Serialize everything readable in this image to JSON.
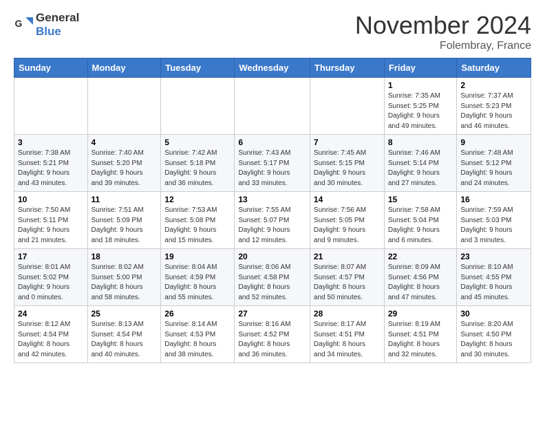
{
  "header": {
    "logo_general": "General",
    "logo_blue": "Blue",
    "month": "November 2024",
    "location": "Folembray, France"
  },
  "weekdays": [
    "Sunday",
    "Monday",
    "Tuesday",
    "Wednesday",
    "Thursday",
    "Friday",
    "Saturday"
  ],
  "weeks": [
    [
      {
        "day": "",
        "info": ""
      },
      {
        "day": "",
        "info": ""
      },
      {
        "day": "",
        "info": ""
      },
      {
        "day": "",
        "info": ""
      },
      {
        "day": "",
        "info": ""
      },
      {
        "day": "1",
        "info": "Sunrise: 7:35 AM\nSunset: 5:25 PM\nDaylight: 9 hours\nand 49 minutes."
      },
      {
        "day": "2",
        "info": "Sunrise: 7:37 AM\nSunset: 5:23 PM\nDaylight: 9 hours\nand 46 minutes."
      }
    ],
    [
      {
        "day": "3",
        "info": "Sunrise: 7:38 AM\nSunset: 5:21 PM\nDaylight: 9 hours\nand 43 minutes."
      },
      {
        "day": "4",
        "info": "Sunrise: 7:40 AM\nSunset: 5:20 PM\nDaylight: 9 hours\nand 39 minutes."
      },
      {
        "day": "5",
        "info": "Sunrise: 7:42 AM\nSunset: 5:18 PM\nDaylight: 9 hours\nand 36 minutes."
      },
      {
        "day": "6",
        "info": "Sunrise: 7:43 AM\nSunset: 5:17 PM\nDaylight: 9 hours\nand 33 minutes."
      },
      {
        "day": "7",
        "info": "Sunrise: 7:45 AM\nSunset: 5:15 PM\nDaylight: 9 hours\nand 30 minutes."
      },
      {
        "day": "8",
        "info": "Sunrise: 7:46 AM\nSunset: 5:14 PM\nDaylight: 9 hours\nand 27 minutes."
      },
      {
        "day": "9",
        "info": "Sunrise: 7:48 AM\nSunset: 5:12 PM\nDaylight: 9 hours\nand 24 minutes."
      }
    ],
    [
      {
        "day": "10",
        "info": "Sunrise: 7:50 AM\nSunset: 5:11 PM\nDaylight: 9 hours\nand 21 minutes."
      },
      {
        "day": "11",
        "info": "Sunrise: 7:51 AM\nSunset: 5:09 PM\nDaylight: 9 hours\nand 18 minutes."
      },
      {
        "day": "12",
        "info": "Sunrise: 7:53 AM\nSunset: 5:08 PM\nDaylight: 9 hours\nand 15 minutes."
      },
      {
        "day": "13",
        "info": "Sunrise: 7:55 AM\nSunset: 5:07 PM\nDaylight: 9 hours\nand 12 minutes."
      },
      {
        "day": "14",
        "info": "Sunrise: 7:56 AM\nSunset: 5:05 PM\nDaylight: 9 hours\nand 9 minutes."
      },
      {
        "day": "15",
        "info": "Sunrise: 7:58 AM\nSunset: 5:04 PM\nDaylight: 9 hours\nand 6 minutes."
      },
      {
        "day": "16",
        "info": "Sunrise: 7:59 AM\nSunset: 5:03 PM\nDaylight: 9 hours\nand 3 minutes."
      }
    ],
    [
      {
        "day": "17",
        "info": "Sunrise: 8:01 AM\nSunset: 5:02 PM\nDaylight: 9 hours\nand 0 minutes."
      },
      {
        "day": "18",
        "info": "Sunrise: 8:02 AM\nSunset: 5:00 PM\nDaylight: 8 hours\nand 58 minutes."
      },
      {
        "day": "19",
        "info": "Sunrise: 8:04 AM\nSunset: 4:59 PM\nDaylight: 8 hours\nand 55 minutes."
      },
      {
        "day": "20",
        "info": "Sunrise: 8:06 AM\nSunset: 4:58 PM\nDaylight: 8 hours\nand 52 minutes."
      },
      {
        "day": "21",
        "info": "Sunrise: 8:07 AM\nSunset: 4:57 PM\nDaylight: 8 hours\nand 50 minutes."
      },
      {
        "day": "22",
        "info": "Sunrise: 8:09 AM\nSunset: 4:56 PM\nDaylight: 8 hours\nand 47 minutes."
      },
      {
        "day": "23",
        "info": "Sunrise: 8:10 AM\nSunset: 4:55 PM\nDaylight: 8 hours\nand 45 minutes."
      }
    ],
    [
      {
        "day": "24",
        "info": "Sunrise: 8:12 AM\nSunset: 4:54 PM\nDaylight: 8 hours\nand 42 minutes."
      },
      {
        "day": "25",
        "info": "Sunrise: 8:13 AM\nSunset: 4:54 PM\nDaylight: 8 hours\nand 40 minutes."
      },
      {
        "day": "26",
        "info": "Sunrise: 8:14 AM\nSunset: 4:53 PM\nDaylight: 8 hours\nand 38 minutes."
      },
      {
        "day": "27",
        "info": "Sunrise: 8:16 AM\nSunset: 4:52 PM\nDaylight: 8 hours\nand 36 minutes."
      },
      {
        "day": "28",
        "info": "Sunrise: 8:17 AM\nSunset: 4:51 PM\nDaylight: 8 hours\nand 34 minutes."
      },
      {
        "day": "29",
        "info": "Sunrise: 8:19 AM\nSunset: 4:51 PM\nDaylight: 8 hours\nand 32 minutes."
      },
      {
        "day": "30",
        "info": "Sunrise: 8:20 AM\nSunset: 4:50 PM\nDaylight: 8 hours\nand 30 minutes."
      }
    ]
  ]
}
